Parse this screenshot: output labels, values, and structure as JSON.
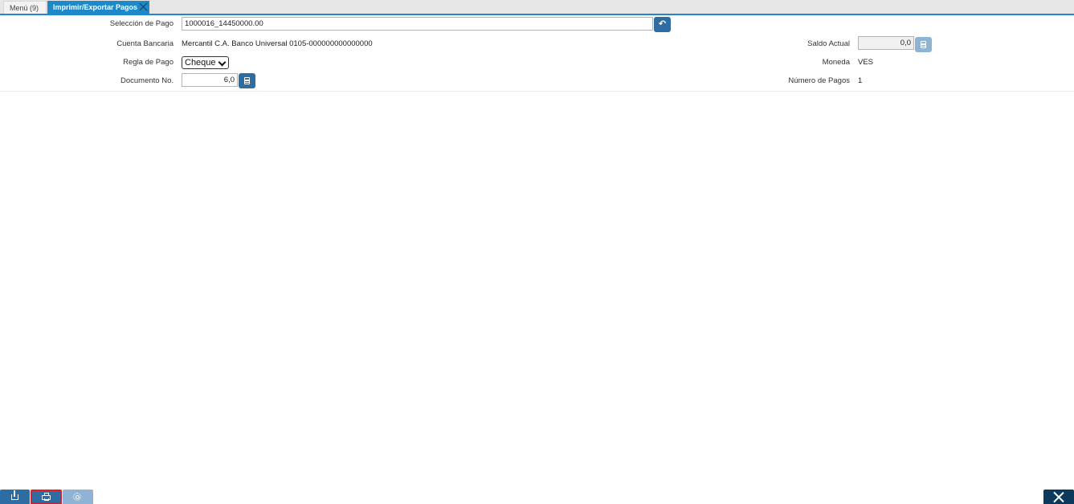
{
  "tabs": {
    "menu_label": "Menú (9)",
    "active_label": "Imprimir/Exportar Pagos"
  },
  "form": {
    "payment_selection": {
      "label": "Selección de Pago",
      "value": "1000016_14450000.00"
    },
    "bank_account": {
      "label": "Cuenta Bancaria",
      "value": "Mercantil C.A. Banco Universal 0105-000000000000000"
    },
    "payment_rule": {
      "label": "Regla de Pago",
      "value": "Cheque"
    },
    "document_no": {
      "label": "Documento No.",
      "value": "6,0"
    },
    "current_balance": {
      "label": "Saldo Actual",
      "value": "0,0"
    },
    "currency": {
      "label": "Moneda",
      "value": "VES"
    },
    "number_of_payments": {
      "label": "Número de Pagos",
      "value": "1"
    }
  },
  "toolbar": {
    "buttons": [
      "export-icon",
      "print-icon",
      "gear-icon"
    ],
    "close": "close-icon"
  },
  "colors": {
    "accent": "#1e88c8",
    "button": "#2e6da4",
    "button_disabled": "#8fb3d4",
    "close_dark": "#0d3a5c",
    "highlight": "#e02020"
  }
}
